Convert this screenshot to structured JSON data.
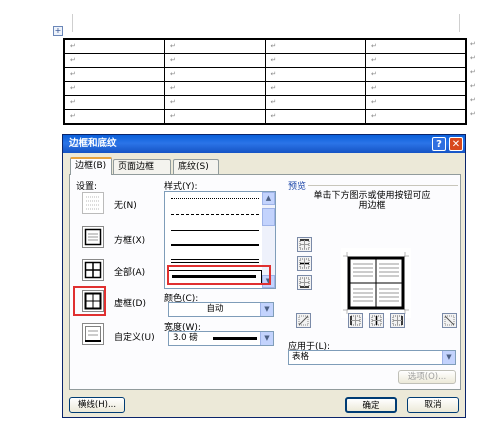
{
  "document": {
    "cell_marker": "↵",
    "rows": 6,
    "cols": 4,
    "table_handle": "+"
  },
  "dialog": {
    "title": "边框和底纹",
    "help_label": "?",
    "close_label": "✕",
    "tabs": [
      {
        "label": "边框(B)",
        "active": true
      },
      {
        "label": "页面边框(P)",
        "active": false
      },
      {
        "label": "底纹(S)",
        "active": false
      }
    ],
    "settings": {
      "label": "设置:",
      "items": [
        {
          "label": "无(N)",
          "icon": "none-icon"
        },
        {
          "label": "方框(X)",
          "icon": "box-icon"
        },
        {
          "label": "全部(A)",
          "icon": "all-icon"
        },
        {
          "label": "虚框(D)",
          "icon": "grid-icon",
          "selected": true
        },
        {
          "label": "自定义(U)",
          "icon": "custom-icon"
        }
      ]
    },
    "style": {
      "label": "样式(Y):",
      "selected_index": 4
    },
    "color": {
      "label": "颜色(C):",
      "value": "自动"
    },
    "width": {
      "label": "宽度(W):",
      "value": "3.0 磅"
    },
    "preview": {
      "label": "预览",
      "instruction": "单击下方图示或使用按钮可应用边框"
    },
    "apply_to": {
      "label": "应用于(L):",
      "value": "表格"
    },
    "buttons": {
      "options": "选项(O)...",
      "horizontal_line": "横线(H)...",
      "ok": "确定",
      "cancel": "取消"
    }
  },
  "colors": {
    "title_bar": "#1553c4",
    "dialog_bg": "#ece9d8",
    "highlight": "#e03030"
  }
}
